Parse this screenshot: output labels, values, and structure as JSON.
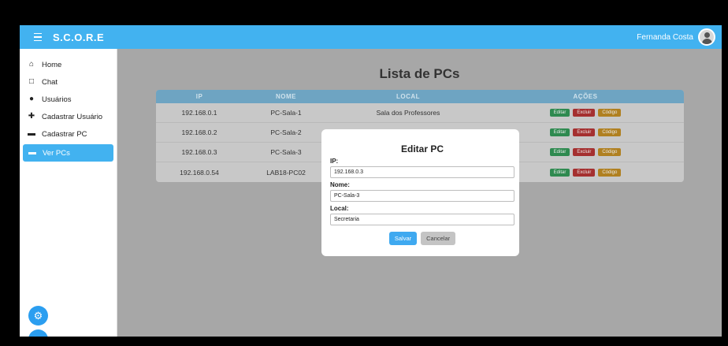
{
  "header": {
    "brand": "S.C.O.R.E",
    "user_name": "Fernanda Costa"
  },
  "sidebar": {
    "items": [
      {
        "label": "Home",
        "icon": "home-icon"
      },
      {
        "label": "Chat",
        "icon": "chat-icon"
      },
      {
        "label": "Usuários",
        "icon": "users-icon"
      },
      {
        "label": "Cadastrar Usuário",
        "icon": "add-user-icon"
      },
      {
        "label": "Cadastrar PC",
        "icon": "monitor-icon"
      },
      {
        "label": "Ver PCs",
        "icon": "monitor-icon",
        "active": true
      }
    ]
  },
  "main": {
    "title": "Lista de PCs",
    "columns": [
      "IP",
      "NOME",
      "LOCAL",
      "AÇÕES"
    ],
    "rows": [
      {
        "ip": "192.168.0.1",
        "nome": "PC-Sala-1",
        "local": "Sala dos Professores"
      },
      {
        "ip": "192.168.0.2",
        "nome": "PC-Sala-2",
        "local": ""
      },
      {
        "ip": "192.168.0.3",
        "nome": "PC-Sala-3",
        "local": ""
      },
      {
        "ip": "192.168.0.54",
        "nome": "LAB18-PC02",
        "local": ""
      }
    ],
    "actions": {
      "edit": "Editar",
      "delete": "Excluir",
      "code": "Código"
    }
  },
  "modal": {
    "title": "Editar PC",
    "ip_label": "IP:",
    "ip_value": "192.168.0.3",
    "nome_label": "Nome:",
    "nome_value": "PC-Sala-3",
    "local_label": "Local:",
    "local_value": "Secretaria",
    "save_label": "Salvar",
    "cancel_label": "Cancelar"
  },
  "colors": {
    "accent": "#42b2f0",
    "edit": "#2f8a50",
    "delete": "#a53030",
    "code": "#b08020"
  }
}
